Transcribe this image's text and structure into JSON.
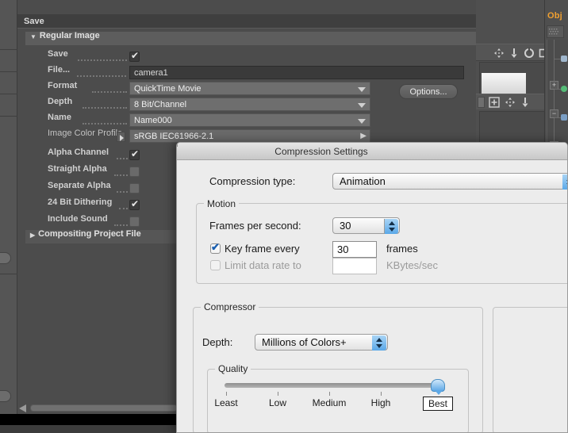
{
  "app": {
    "object_tab_label": "Obj"
  },
  "save_panel": {
    "title": "Save",
    "section_regular_image": "Regular Image",
    "section_compositing": "Compositing Project File",
    "rows": [
      {
        "label": "Save",
        "type": "checkbox",
        "checked": true
      },
      {
        "label": "File...",
        "type": "text",
        "value": "camera1"
      },
      {
        "label": "Format",
        "type": "dropdown",
        "value": "QuickTime Movie"
      },
      {
        "label": "Depth",
        "type": "dropdown",
        "value": "8 Bit/Channel"
      },
      {
        "label": "Name",
        "type": "dropdown",
        "value": "Name000"
      },
      {
        "label": "Image Color Profile",
        "type": "profile",
        "value": "sRGB IEC61966-2.1"
      },
      {
        "label": "Alpha Channel",
        "type": "checkbox",
        "checked": true
      },
      {
        "label": "Straight Alpha",
        "type": "checkbox",
        "checked": false
      },
      {
        "label": "Separate Alpha",
        "type": "checkbox",
        "checked": false
      },
      {
        "label": "24 Bit Dithering",
        "type": "checkbox",
        "checked": true
      },
      {
        "label": "Include Sound",
        "type": "checkbox",
        "checked": false
      }
    ],
    "options_button": "Options..."
  },
  "dialog": {
    "title": "Compression Settings",
    "compression_type_label": "Compression type:",
    "compression_type_value": "Animation",
    "motion": {
      "group_title": "Motion",
      "fps_label": "Frames per second:",
      "fps_value": "30",
      "key_frame_label": "Key frame every",
      "key_frame_value": "30",
      "key_frame_unit": "frames",
      "key_frame_checked": true,
      "limit_rate_label": "Limit data rate to",
      "limit_rate_value": "",
      "limit_rate_unit": "KBytes/sec",
      "limit_rate_checked": false
    },
    "compressor": {
      "group_title": "Compressor",
      "depth_label": "Depth:",
      "depth_value": "Millions of Colors+",
      "quality": {
        "group_title": "Quality",
        "ticks": [
          "Least",
          "Low",
          "Medium",
          "High",
          "Best"
        ],
        "selected": "Best",
        "selected_index": 4
      }
    }
  }
}
